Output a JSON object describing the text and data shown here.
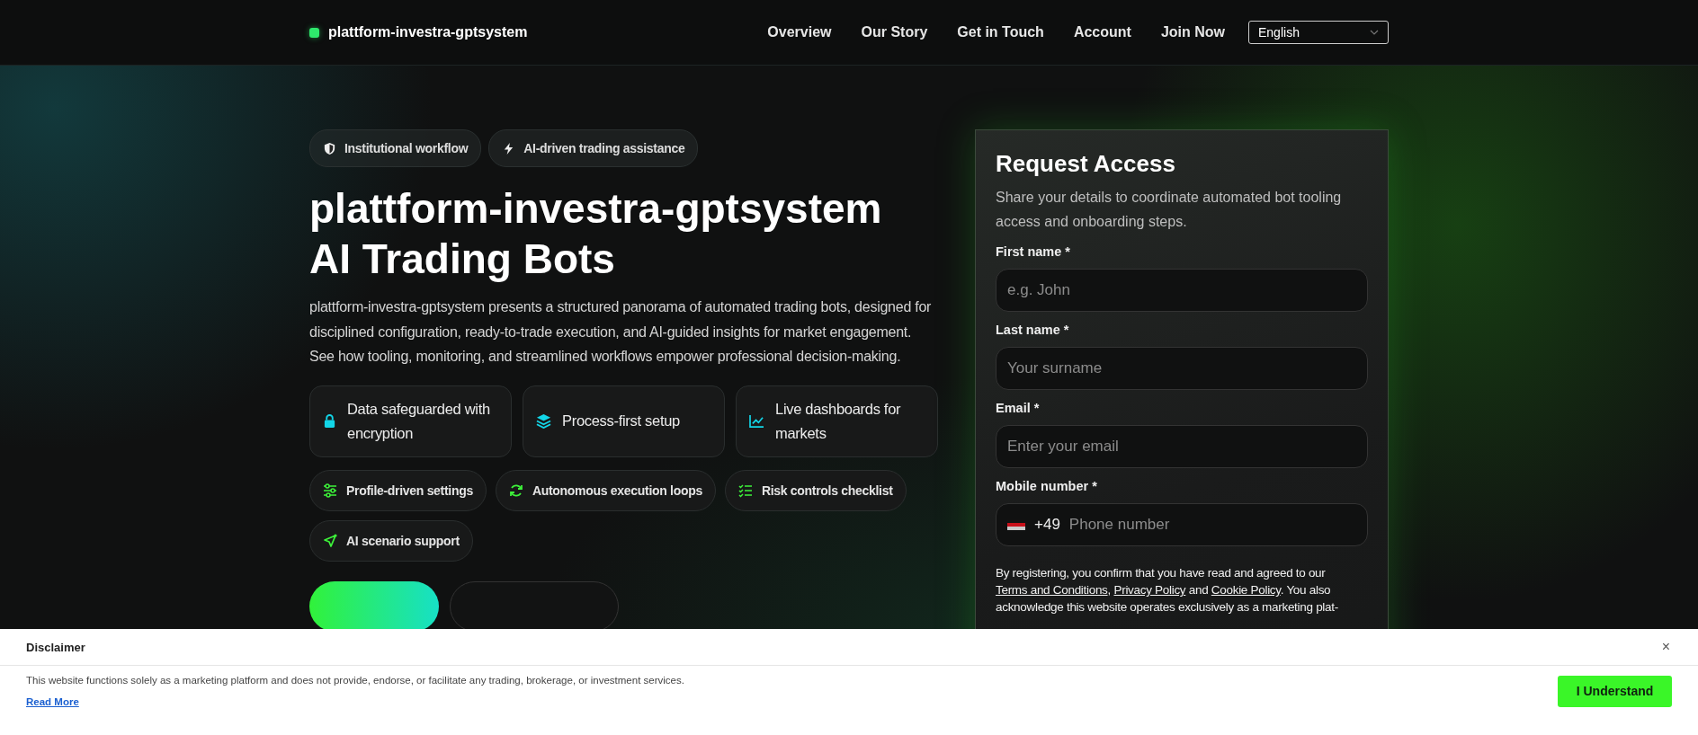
{
  "header": {
    "brand": "plattform-investra-gptsystem",
    "nav": [
      {
        "label": "Overview"
      },
      {
        "label": "Our Story"
      },
      {
        "label": "Get in Touch"
      },
      {
        "label": "Account"
      },
      {
        "label": "Join Now"
      }
    ],
    "language": "English"
  },
  "hero": {
    "badges": [
      {
        "kind": "shield",
        "label": "Institutional workflow"
      },
      {
        "kind": "bolt",
        "label": "AI-driven trading assistance"
      }
    ],
    "title_lines": [
      "plattform-investra-gptsystem",
      "AI Trading Bots"
    ],
    "description": "plattform-investra-gptsystem presents a structured panorama of automated trading bots, designed for disciplined configuration, ready-to-trade execution, and AI-guided insights for market engagement. See how tooling, monitoring, and streamlined workflows empower professional decision-making.",
    "features": [
      {
        "kind": "lock",
        "label": "Data safeguarded with encryption"
      },
      {
        "kind": "layers",
        "label": "Process-first setup"
      },
      {
        "kind": "chart",
        "label": "Live dashboards for markets"
      }
    ],
    "tags": [
      {
        "kind": "sliders",
        "label": "Profile-driven settings"
      },
      {
        "kind": "refresh",
        "label": "Autonomous execution loops"
      },
      {
        "kind": "checklist",
        "label": "Risk controls checklist"
      },
      {
        "kind": "send",
        "label": "AI scenario support"
      }
    ],
    "buttons": [
      {
        "kind": "primary"
      },
      {
        "kind": "secondary"
      }
    ]
  },
  "form": {
    "title": "Request Access",
    "subtitle": "Share your details to coordinate automated bot tooling access and onboarding steps.",
    "fields": [
      {
        "kind": "text",
        "label": "First name *",
        "placeholder": "e.g. John"
      },
      {
        "kind": "text",
        "label": "Last name *",
        "placeholder": "Your surname"
      },
      {
        "kind": "text",
        "label": "Email *",
        "placeholder": "Enter your email"
      },
      {
        "kind": "phone",
        "label": "Mobile number *",
        "prefix": "+49",
        "placeholder": "Phone number"
      }
    ],
    "consent": [
      {
        "kind": "text",
        "text": "By registering, you confirm that you have read and agreed to our "
      },
      {
        "kind": "link",
        "text": "Terms and Conditions"
      },
      {
        "kind": "text",
        "text": ", "
      },
      {
        "kind": "link",
        "text": "Privacy Policy"
      },
      {
        "kind": "text",
        "text": " and "
      },
      {
        "kind": "link",
        "text": "Cookie Policy"
      },
      {
        "kind": "text",
        "text": ". You also acknowledge this website operates exclusively as a marketing plat-"
      }
    ]
  },
  "disclaimer": {
    "title": "Disclaimer",
    "close": "×",
    "text": "This website functions solely as a marketing platform and does not provide, endorse, or facilitate any trading, brokerage, or investment services.",
    "link": "Read More",
    "button": "I Understand"
  }
}
